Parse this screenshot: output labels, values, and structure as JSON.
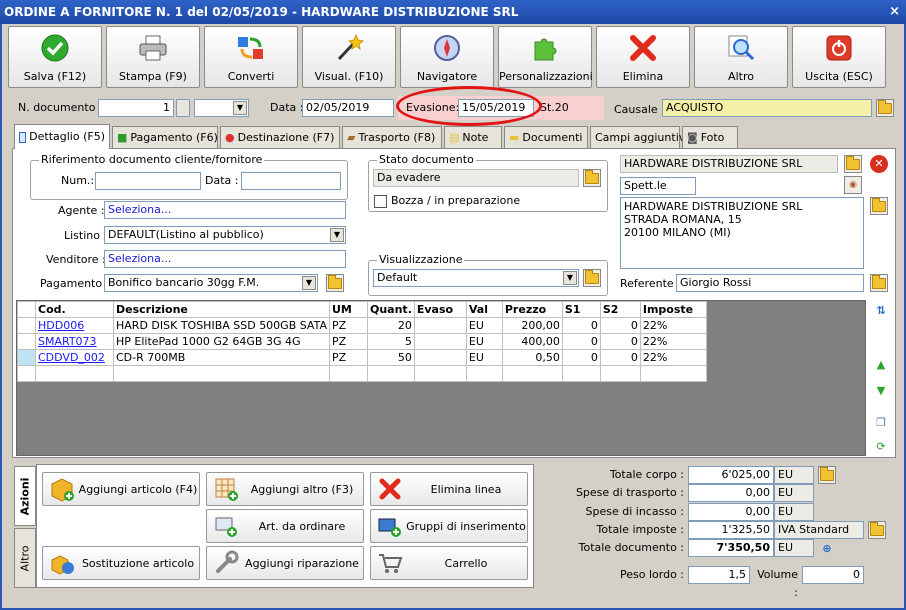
{
  "window": {
    "title": "ORDINE A FORNITORE N. 1 del 02/05/2019 - HARDWARE DISTRIBUZIONE SRL",
    "close_glyph": "×"
  },
  "toolbar": [
    {
      "label": "Salva (F12)",
      "icon": "check-icon"
    },
    {
      "label": "Stampa (F9)",
      "icon": "printer-icon"
    },
    {
      "label": "Converti",
      "icon": "convert-icon"
    },
    {
      "label": "Visual. (F10)",
      "icon": "magic-wand-icon"
    },
    {
      "label": "Navigatore",
      "icon": "compass-icon"
    },
    {
      "label": "Personalizzazioni",
      "icon": "puzzle-icon"
    },
    {
      "label": "Elimina",
      "icon": "delete-x-icon"
    },
    {
      "label": "Altro",
      "icon": "magnifier-icon"
    },
    {
      "label": "Uscita (ESC)",
      "icon": "power-icon"
    }
  ],
  "header": {
    "ndoc_label": "N. documento :",
    "ndoc_value": "1",
    "data_label": "Data :",
    "data_value": "02/05/2019",
    "evasione_label": "Evasione:",
    "evasione_value": "15/05/2019",
    "settimana": "St.20",
    "causale_label": "Causale :",
    "causale_value": "ACQUISTO"
  },
  "tabs": [
    {
      "label": "Dettaglio (F5)",
      "icon": "detail-icon"
    },
    {
      "label": "Pagamento (F6)",
      "icon": "money-icon"
    },
    {
      "label": "Destinazione (F7)",
      "icon": "destination-icon"
    },
    {
      "label": "Trasporto (F8)",
      "icon": "truck-icon"
    },
    {
      "label": "Note",
      "icon": "note-icon"
    },
    {
      "label": "Documenti",
      "icon": "folder-icon"
    },
    {
      "label": "Campi aggiuntivi",
      "icon": ""
    },
    {
      "label": "Foto",
      "icon": "camera-icon"
    }
  ],
  "riferimento": {
    "title": "Riferimento documento cliente/fornitore",
    "num_label": "Num.:",
    "data_label": "Data :"
  },
  "stato": {
    "title": "Stato documento",
    "value": "Da evadere",
    "bozza_label": "Bozza / in preparazione"
  },
  "visualizzazione": {
    "title": "Visualizzazione",
    "value": "Default"
  },
  "fields": {
    "agente_label": "Agente :",
    "agente_value": "Seleziona...",
    "listino_label": "Listino :",
    "listino_value": "DEFAULT(Listino al pubblico)",
    "venditore_label": "Venditore :",
    "venditore_value": "Seleziona...",
    "pagamento_label": "Pagamento :",
    "pagamento_value": "Bonifico bancario 30gg F.M."
  },
  "fornitore": {
    "name": "HARDWARE DISTRIBUZIONE SRL",
    "salutation": "Spett.le",
    "address": [
      "HARDWARE DISTRIBUZIONE SRL",
      "STRADA ROMANA, 15",
      "20100 MILANO (MI)"
    ],
    "referente_label": "Referente",
    "referente_value": "Giorgio Rossi"
  },
  "grid": {
    "headers": [
      "Cod.",
      "Descrizione",
      "UM",
      "Quant.",
      "Evaso",
      "Val",
      "Prezzo",
      "S1",
      "S2",
      "Imposte"
    ],
    "rows": [
      [
        "HDD006",
        "HARD DISK TOSHIBA SSD 500GB SATA",
        "PZ",
        "20",
        "",
        "EU",
        "200,00",
        "0",
        "0",
        "22%"
      ],
      [
        "SMART073",
        "HP ElitePad 1000 G2 64GB 3G 4G",
        "PZ",
        "5",
        "",
        "EU",
        "400,00",
        "0",
        "0",
        "22%"
      ],
      [
        "CDDVD_002",
        "CD-R 700MB",
        "PZ",
        "50",
        "",
        "EU",
        "0,50",
        "0",
        "0",
        "22%"
      ]
    ]
  },
  "actions": {
    "vtab_azioni": "Azioni",
    "vtab_altro": "Altro",
    "buttons": [
      {
        "label": "Aggiungi articolo (F4)",
        "icon": "add-box-icon"
      },
      {
        "label": "Aggiungi altro (F3)",
        "icon": "add-grid-icon"
      },
      {
        "label": "Elimina linea",
        "icon": "delete-x-icon"
      },
      {
        "label": "Art. da ordinare",
        "icon": "order-icon"
      },
      {
        "label": "Gruppi di inserimento",
        "icon": "group-add-icon"
      },
      {
        "label": "Sostituzione articolo",
        "icon": "replace-icon"
      },
      {
        "label": "Aggiungi riparazione",
        "icon": "wrench-icon"
      },
      {
        "label": "Carrello",
        "icon": "cart-icon"
      }
    ]
  },
  "totals": {
    "corpo_label": "Totale corpo :",
    "corpo_value": "6'025,00",
    "corpo_cur": "EU",
    "trasporto_label": "Spese di trasporto :",
    "trasporto_value": "0,00",
    "trasporto_cur": "EU",
    "incasso_label": "Spese di incasso :",
    "incasso_value": "0,00",
    "incasso_cur": "EU",
    "imposte_label": "Totale imposte :",
    "imposte_value": "1'325,50",
    "imposte_type": "IVA Standard",
    "documento_label": "Totale documento :",
    "documento_value": "7'350,50",
    "documento_cur": "EU",
    "peso_label": "Peso lordo :",
    "peso_value": "1,5",
    "volume_label": "Volume :",
    "volume_value": "0"
  }
}
